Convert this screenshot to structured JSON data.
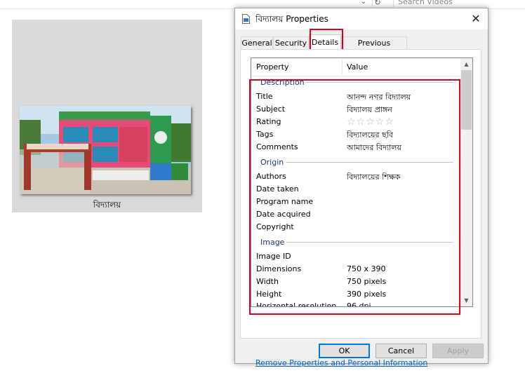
{
  "explorer": {
    "search_placeholder": "Search Videos",
    "thumbnail_caption": "বিদ্যালয়"
  },
  "dialog": {
    "title": "বিদ্যালয় Properties",
    "close": "✕",
    "tabs": [
      "General",
      "Security",
      "Details",
      "Previous Versions"
    ],
    "active_tab": "Details",
    "columns": {
      "property": "Property",
      "value": "Value"
    },
    "groups": {
      "description": "Description",
      "origin": "Origin",
      "image": "Image"
    },
    "description_rows": [
      {
        "name": "Title",
        "value": "আনন্দ নগর বিদ্যালয়"
      },
      {
        "name": "Subject",
        "value": "বিদ্যালয় প্রাঙ্গন"
      },
      {
        "name": "Rating",
        "value": ""
      },
      {
        "name": "Tags",
        "value": "বিদ্যালয়ের ছবি"
      },
      {
        "name": "Comments",
        "value": "আমাদের বিদ্যালয়"
      }
    ],
    "rating_stars": "☆☆☆☆☆",
    "rating_value": 0,
    "origin_rows": [
      {
        "name": "Authors",
        "value": "বিদ্যালয়ের শিক্ষক"
      },
      {
        "name": "Date taken",
        "value": ""
      },
      {
        "name": "Program name",
        "value": ""
      },
      {
        "name": "Date acquired",
        "value": ""
      },
      {
        "name": "Copyright",
        "value": ""
      }
    ],
    "image_rows": [
      {
        "name": "Image ID",
        "value": ""
      },
      {
        "name": "Dimensions",
        "value": "750 x 390"
      },
      {
        "name": "Width",
        "value": "750 pixels"
      },
      {
        "name": "Height",
        "value": "390 pixels"
      },
      {
        "name": "Horizontal resolution",
        "value": "96 dpi"
      }
    ],
    "remove_link": "Remove Properties and Personal Information",
    "buttons": {
      "ok": "OK",
      "cancel": "Cancel",
      "apply": "Apply"
    }
  },
  "colors": {
    "highlight": "#e0001b",
    "group_heading": "#1e3287",
    "link": "#0066cc"
  }
}
